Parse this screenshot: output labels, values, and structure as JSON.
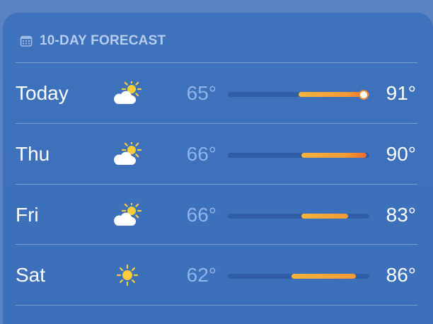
{
  "widget": {
    "title": "10-DAY FORECAST",
    "header_icon": "calendar-icon"
  },
  "colors": {
    "warm_start": "#f7b43c",
    "warm_mid": "#f49a35",
    "hot_end": "#ef6a2f"
  },
  "forecast": [
    {
      "day": "Today",
      "icon": "partly-sunny-icon",
      "low": "65°",
      "high": "91°",
      "range_low": 65,
      "range_high": 91,
      "current": 89
    },
    {
      "day": "Thu",
      "icon": "partly-sunny-icon",
      "low": "66°",
      "high": "90°",
      "range_low": 66,
      "range_high": 90
    },
    {
      "day": "Fri",
      "icon": "partly-sunny-icon",
      "low": "66°",
      "high": "83°",
      "range_low": 66,
      "range_high": 83
    },
    {
      "day": "Sat",
      "icon": "sunny-icon",
      "low": "62°",
      "high": "86°",
      "range_low": 62,
      "range_high": 86
    }
  ]
}
